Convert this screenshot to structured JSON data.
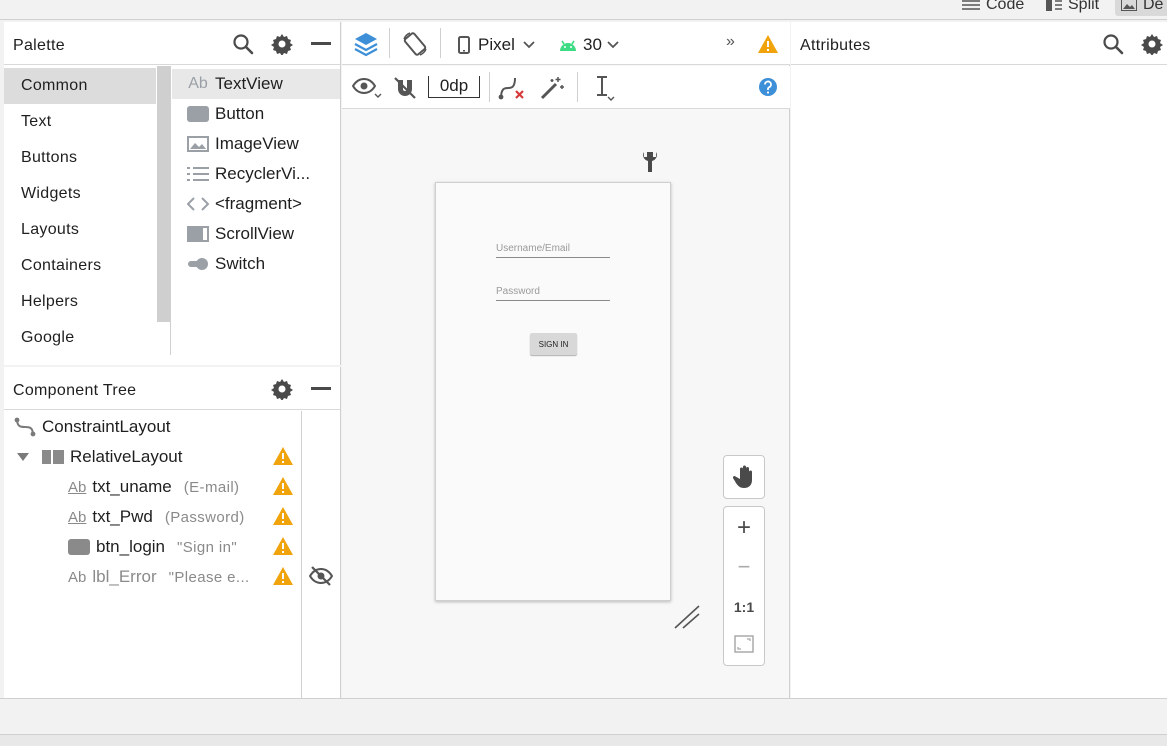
{
  "topbar": {
    "modes": [
      {
        "label": "Code",
        "icon": "lines-icon"
      },
      {
        "label": "Split",
        "icon": "split-icon"
      },
      {
        "label": "De",
        "icon": "design-icon"
      }
    ]
  },
  "palette": {
    "title": "Palette",
    "categories": [
      "Common",
      "Text",
      "Buttons",
      "Widgets",
      "Layouts",
      "Containers",
      "Helpers",
      "Google"
    ],
    "widgets": [
      {
        "label": "TextView",
        "icon": "textview-icon"
      },
      {
        "label": "Button",
        "icon": "button-icon"
      },
      {
        "label": "ImageView",
        "icon": "imageview-icon"
      },
      {
        "label": "RecyclerVi...",
        "icon": "recyclerview-icon"
      },
      {
        "label": "<fragment>",
        "icon": "fragment-icon"
      },
      {
        "label": "ScrollView",
        "icon": "scrollview-icon"
      },
      {
        "label": "Switch",
        "icon": "switch-icon"
      }
    ]
  },
  "component_tree": {
    "title": "Component Tree",
    "items": [
      {
        "name": "ConstraintLayout",
        "sub": ""
      },
      {
        "name": "RelativeLayout",
        "sub": ""
      },
      {
        "name": "txt_uname",
        "sub": "(E-mail)"
      },
      {
        "name": "txt_Pwd",
        "sub": "(Password)"
      },
      {
        "name": "btn_login",
        "sub": "\"Sign in\""
      },
      {
        "name": "lbl_Error",
        "sub": "\"Please e..."
      }
    ]
  },
  "design_toolbar": {
    "device": "Pixel",
    "api_level": "30",
    "margin_value": "0dp",
    "overflow": "»"
  },
  "preview": {
    "username_hint": "Username/Email",
    "password_hint": "Password",
    "sign_in_label": "SIGN IN"
  },
  "zoom_controls": {
    "zoom_in": "+",
    "zoom_out": "−",
    "actual_size": "1:1"
  },
  "attributes": {
    "title": "Attributes"
  },
  "colors": {
    "accent_blue": "#3d8fd8",
    "warning": "#f0a30a",
    "android_green": "#3ddc84"
  }
}
